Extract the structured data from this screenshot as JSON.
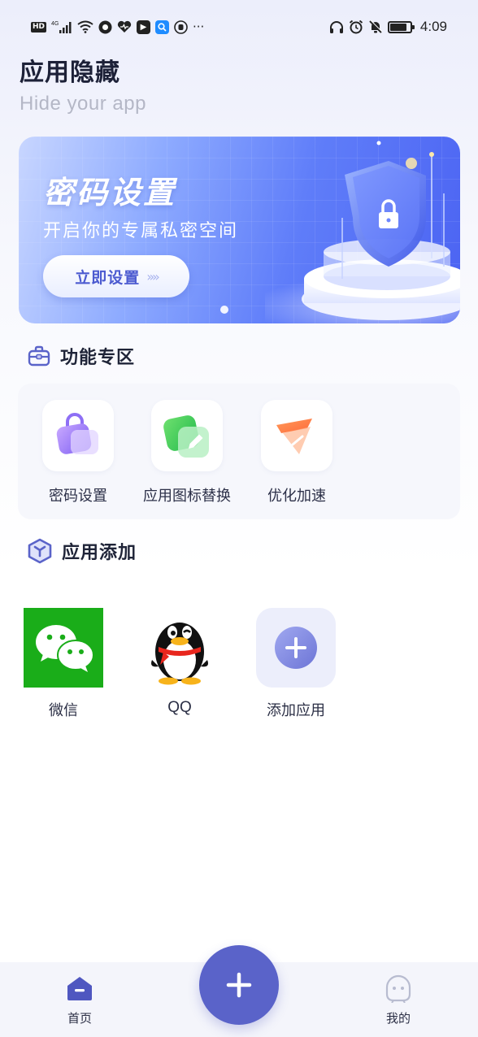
{
  "status_bar": {
    "left_badge": "HD",
    "network": "4G",
    "more": "···",
    "time": "4:09",
    "icons": [
      "hd-icon",
      "signal-icon",
      "wifi-icon",
      "app-notification-icon",
      "health-icon",
      "app-tile-icon",
      "search-app-icon",
      "hand-icon",
      "more-icon",
      "headphones-icon",
      "alarm-icon",
      "mute-bell-icon",
      "battery-icon"
    ]
  },
  "header": {
    "title": "应用隐藏",
    "subtitle": "Hide your app"
  },
  "banner": {
    "title": "密码设置",
    "subtitle": "开启你的专属私密空间",
    "button_label": "立即设置",
    "button_chevrons": "»»",
    "art_icon": "shield-lock-icon"
  },
  "features_section": {
    "title": "功能专区",
    "icon": "toolbox-icon",
    "items": [
      {
        "label": "密码设置",
        "icon": "lock-bag-icon"
      },
      {
        "label": "应用图标替换",
        "icon": "edit-icon"
      },
      {
        "label": "优化加速",
        "icon": "speed-icon"
      }
    ]
  },
  "apps_section": {
    "title": "应用添加",
    "icon": "cube-icon",
    "items": [
      {
        "label": "微信",
        "icon": "wechat-icon"
      },
      {
        "label": "QQ",
        "icon": "qq-penguin-icon"
      },
      {
        "label": "添加应用",
        "icon": "add-circle-icon"
      }
    ]
  },
  "bottom_nav": {
    "home_label": "首页",
    "mine_label": "我的",
    "fab_icon": "plus-icon"
  },
  "colors": {
    "accent": "#5a63c9",
    "banner_start": "#c8d6ff",
    "banner_end": "#4b63f2",
    "wechat_green": "#1aad19"
  }
}
